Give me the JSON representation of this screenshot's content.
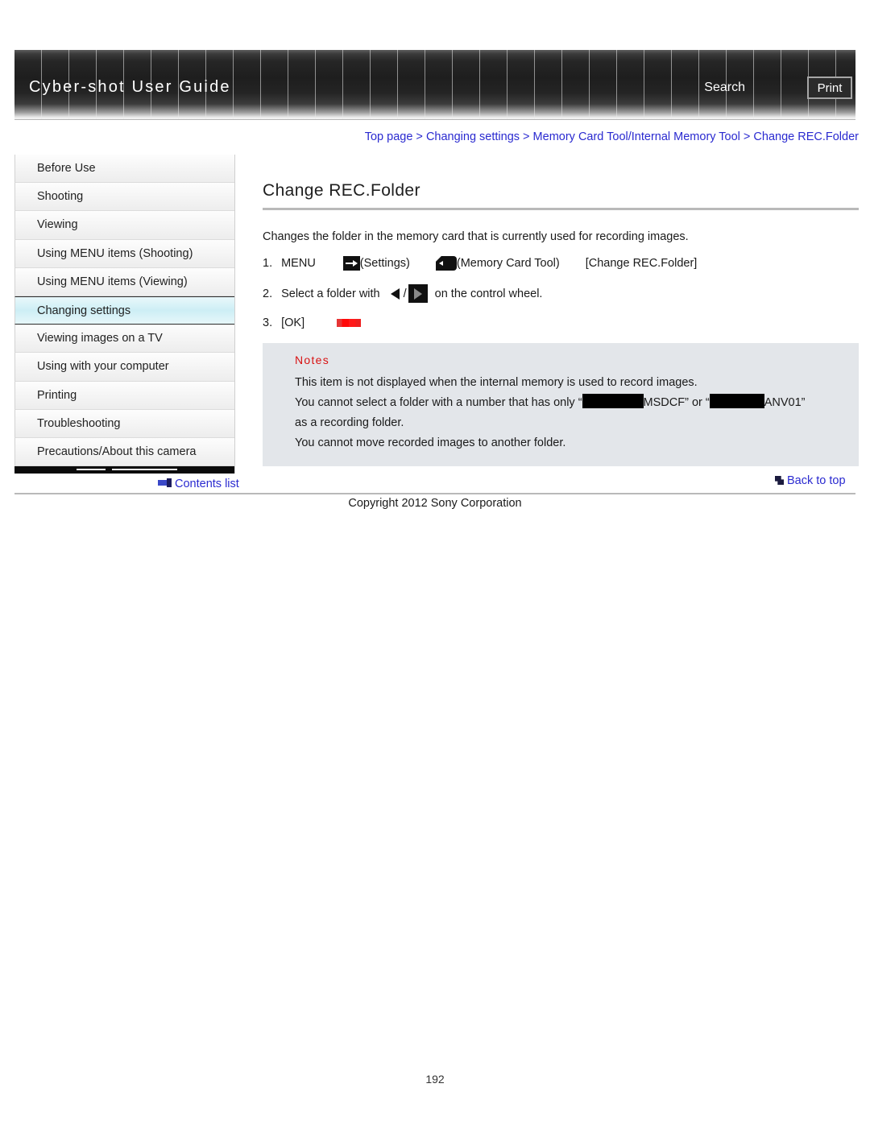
{
  "header": {
    "site_title": "Cyber-shot User Guide",
    "search_label": "Search",
    "print_label": "Print"
  },
  "breadcrumb": {
    "separator": " > ",
    "items": [
      "Top page",
      "Changing settings",
      "Memory Card Tool/Internal Memory Tool",
      "Change REC.Folder"
    ]
  },
  "sidebar": {
    "items": [
      {
        "label": "Before Use",
        "selected": false
      },
      {
        "label": "Shooting",
        "selected": false
      },
      {
        "label": "Viewing",
        "selected": false
      },
      {
        "label": "Using MENU items (Shooting)",
        "selected": false
      },
      {
        "label": "Using MENU items (Viewing)",
        "selected": false
      },
      {
        "label": "Changing settings",
        "selected": true
      },
      {
        "label": "Viewing images on a TV",
        "selected": false
      },
      {
        "label": "Using with your computer",
        "selected": false
      },
      {
        "label": "Printing",
        "selected": false
      },
      {
        "label": "Troubleshooting",
        "selected": false
      },
      {
        "label": "Precautions/About this camera",
        "selected": false
      }
    ],
    "contents_list_label": "Contents list"
  },
  "main": {
    "title": "Change REC.Folder",
    "intro": "Changes the folder in the memory card that is currently used for recording images.",
    "steps": [
      {
        "number": "1.",
        "text_before_icon": "MENU",
        "settings_label": "(Settings)",
        "memcard_label": "(Memory Card Tool)",
        "target_label": "[Change REC.Folder]"
      },
      {
        "number": "2.",
        "text_before": "Select a folder with",
        "separator": "/",
        "text_after": "on the control wheel."
      },
      {
        "number": "3.",
        "text": "[OK]"
      }
    ],
    "notes": {
      "title": "Notes",
      "lines": [
        "This item is not displayed when the internal memory is used to record images.",
        "You cannot select a folder with a number that has only “",
        "MSDCF” or “",
        "ANV01”",
        "as a recording folder.",
        "You cannot move recorded images to another folder."
      ]
    }
  },
  "footer": {
    "back_to_top_label": "Back to top",
    "copyright": "Copyright 2012 Sony Corporation",
    "page_number": "192"
  },
  "colors": {
    "link": "#2a2ad0",
    "notes_title": "#d81212",
    "notes_bg": "#e3e6ea",
    "selected_sidebar": "#cdeef5"
  }
}
